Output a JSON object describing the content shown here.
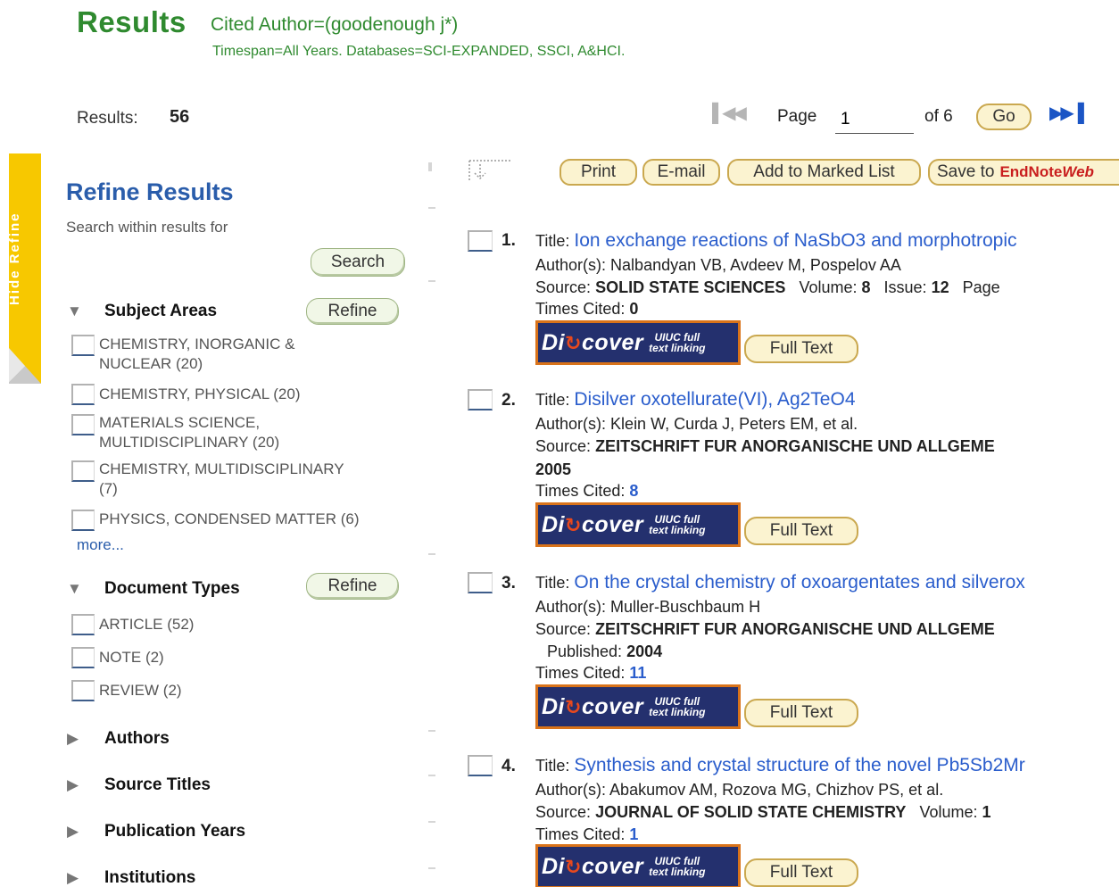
{
  "header": {
    "title": "Results",
    "query": "Cited Author=(goodenough j*)",
    "timespan": "Timespan=All Years. Databases=SCI-EXPANDED, SSCI, A&HCI."
  },
  "results": {
    "label": "Results:",
    "count": "56"
  },
  "pager": {
    "page_label": "Page",
    "current_page": "1",
    "of_label": "of 6",
    "go_label": "Go",
    "first_icon": "first-page-icon",
    "next_icon": "next-last-page-icon"
  },
  "hide_refine": {
    "label": "Hide Refine"
  },
  "refine": {
    "title": "Refine Results",
    "search_within": "Search within results for",
    "search_button": "Search",
    "refine_button": "Refine",
    "subject_areas": {
      "heading": "Subject Areas",
      "items": [
        {
          "label_line1": "CHEMISTRY, INORGANIC &",
          "label_line2": "NUCLEAR (20)"
        },
        {
          "label_line1": "CHEMISTRY, PHYSICAL (20)",
          "label_line2": ""
        },
        {
          "label_line1": "MATERIALS SCIENCE,",
          "label_line2": "MULTIDISCIPLINARY (20)"
        },
        {
          "label_line1": "CHEMISTRY, MULTIDISCIPLINARY",
          "label_line2": "(7)"
        },
        {
          "label_line1": "PHYSICS, CONDENSED MATTER (6)",
          "label_line2": ""
        }
      ],
      "more": "more..."
    },
    "document_types": {
      "heading": "Document Types",
      "items": [
        "ARTICLE (52)",
        "NOTE (2)",
        "REVIEW (2)"
      ]
    },
    "collapsed_sections": [
      "Authors",
      "Source Titles",
      "Publication Years",
      "Institutions"
    ]
  },
  "toolbar": {
    "print": "Print",
    "email": "E-mail",
    "add_marked": "Add to Marked List",
    "save_to": "Save to",
    "endnote": "EndNote",
    "endnote_web": "Web"
  },
  "discover": {
    "word_pre": "Di",
    "word_post": "cover",
    "small1": "UIUC full",
    "small2": "text linking"
  },
  "full_text": "Full Text",
  "records": [
    {
      "num": "1.",
      "title_label": "Title:",
      "title": "Ion exchange reactions of NaSbO3 and morphotropic",
      "authors_label": "Author(s):",
      "authors": "Nalbandyan VB, Avdeev M, Pospelov AA",
      "source_label": "Source:",
      "source": "SOLID STATE SCIENCES",
      "source_extra_1_label": "Volume:",
      "source_extra_1": "8",
      "source_extra_2_label": "Issue:",
      "source_extra_2": "12",
      "source_extra_3_label": "Page",
      "cited_label": "Times Cited:",
      "cited": "0"
    },
    {
      "num": "2.",
      "title_label": "Title:",
      "title": "Disilver oxotellurate(VI), Ag2TeO4",
      "authors_label": "Author(s):",
      "authors": "Klein W, Curda J, Peters EM, et al.",
      "source_label": "Source:",
      "source": "ZEITSCHRIFT FUR ANORGANISCHE UND ALLGEME",
      "source_line2": "2005",
      "cited_label": "Times Cited:",
      "cited": "8"
    },
    {
      "num": "3.",
      "title_label": "Title:",
      "title": "On the crystal chemistry of oxoargentates and silverox",
      "authors_label": "Author(s):",
      "authors": "Muller-Buschbaum H",
      "source_label": "Source:",
      "source": "ZEITSCHRIFT FUR ANORGANISCHE UND ALLGEME",
      "published_label": "Published:",
      "published": "2004",
      "cited_label": "Times Cited:",
      "cited": "11"
    },
    {
      "num": "4.",
      "title_label": "Title:",
      "title": "Synthesis and crystal structure of the novel Pb5Sb2Mr",
      "authors_label": "Author(s):",
      "authors": "Abakumov AM, Rozova MG, Chizhov PS, et al.",
      "source_label": "Source:",
      "source": "JOURNAL OF SOLID STATE CHEMISTRY",
      "source_extra_1_label": "Volume:",
      "source_extra_1": "1",
      "cited_label": "Times Cited:",
      "cited": "1"
    }
  ]
}
